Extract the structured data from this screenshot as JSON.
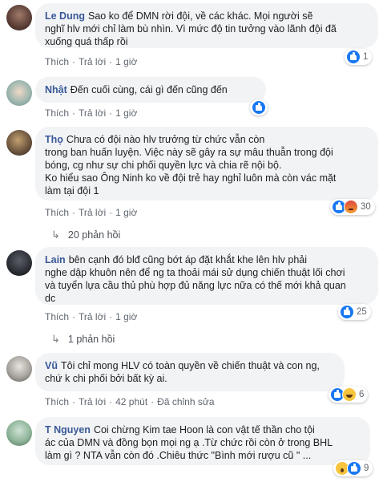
{
  "actions": {
    "like": "Thích",
    "reply": "Trả lời",
    "dot": "·",
    "edit": "Đã chỉnh sửa"
  },
  "comments": [
    {
      "author": "Le Dung",
      "text_lines": [
        "Sao ko để DMN rời đội, về các khác. Mọi người sẽ",
        "nghĩ hlv mới chỉ làm bù nhìn. Vì mức độ tin tưởng vào lãnh đội đã",
        "xuống quá thấp rồi"
      ],
      "time": "1 giờ",
      "reactions": [
        "like"
      ],
      "reaction_count": "1"
    },
    {
      "author": "Nhật",
      "text_lines": [
        "Đến cuối cùng, cái gì đến cũng đến"
      ],
      "time": "1 giờ",
      "reactions": [
        "like"
      ],
      "reaction_count": ""
    },
    {
      "author": "Thọ",
      "text_lines": [
        "Chưa có đội nào hlv trưởng từ chức vẫn còn",
        "trong ban huấn luyện. Việc này sẽ gây ra sự mâu thuẫn trong đội",
        "bóng, cg như sự chi phối quyền lực và chia rẽ nội bộ.",
        "Ko hiểu sao Ông Ninh ko về đội trẻ hay nghỉ luôn mà còn vác mặt",
        "làm tại đội 1"
      ],
      "time": "1 giờ",
      "reactions": [
        "like",
        "angry"
      ],
      "reaction_count": "30",
      "replies": "20 phản hồi"
    },
    {
      "author": "Lain",
      "text_lines": [
        "bên cạnh đó blđ cũng bớt áp đặt khắt khe lên hlv phải",
        "nghe dập khuôn nên để ng ta thoải mái sử dụng chiến thuật lối chơi",
        "và tuyển lựa cầu thủ phù hợp đủ năng lực nữa có thế mới khả quan",
        "dc"
      ],
      "time": "1 giờ",
      "reactions": [
        "like"
      ],
      "reaction_count": "25",
      "replies": "1 phản hồi"
    },
    {
      "author": "Vũ",
      "text_lines": [
        "Tôi chỉ mong HLV có toàn quyền về chiến thuật và con ng,",
        "chứ k chi phối bởi bất kỳ ai."
      ],
      "time": "42 phút",
      "edited": true,
      "reactions": [
        "like",
        "haha"
      ],
      "reaction_count": "6"
    },
    {
      "author": "T Nguyen",
      "text_lines": [
        "Coi chừng Kim tae Hoon là con vật tế thần cho tội",
        "ác của DMN và đồng bọn mọi ng ạ .Từ chức rồi còn ở trong BHL",
        "làm gì ? NTA vẫn còn đó .Chiêu thức \"Bình mới rượu cũ \" ..."
      ],
      "time": "1 giờ",
      "reactions": [
        "wow",
        "like"
      ],
      "reaction_count": "9"
    }
  ]
}
